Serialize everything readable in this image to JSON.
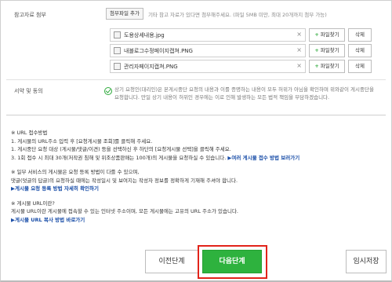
{
  "attachments": {
    "label": "참고자료 첨부",
    "add_button": "첨부파일 추가",
    "hint": "기타 참고 자료가 있다면 첨부해주세요. (파일 5MB 미만, 최대 20개까지 첨부 가능)",
    "find_label": "파일찾기",
    "delete_label": "삭제",
    "files": [
      {
        "name": "도용상세내용.jpg"
      },
      {
        "name": "내블로그수정페이지캡쳐.PNG"
      },
      {
        "name": "관리자페이지캡쳐.PNG"
      }
    ]
  },
  "signature": {
    "label": "서약 및 동의",
    "text": "상기 요청인(대리인)은 본게시중단 요청의 내용과 이를 증명하는 내용이 모두 허위가 아님을 확인하며 위와같이 게시중단을 요청합니다. 만일 상기 내용이 허위인 경우에는 이로 인해 발생하는 모든 법적 책임을 부담하겠습니다."
  },
  "notes": {
    "url_method_title": "※ URL 접수방법",
    "url_method_1": "1. 게시물의 URL주소 입력 후 [요청게시물 조회]를 클릭해 주세요.",
    "url_method_2": "1. 게시중단 요청 대상 (게시물/댓글/이견) 등을 선택하신 후 하단의 [요청게시물 선택]을 클릭해 주세요.",
    "url_method_3": "3. 1회 접수 시 최대 30개(저작권 침해 및 위조상품판매는 100개)의 게시물을 요청하실 수 있습니다.",
    "url_method_link": "▶여러 게시물 접수 방법 보러가기",
    "service_note_1": "※ 일부 서비스의 게시물은 요청 등록 방법이 다를 수 있으며,",
    "service_note_2": "댓글(덧글의 답글)의 요청하실 때에는 작성일시 및 보여지는 작성자 정보를 정확하게 기재해 주셔야 합니다.",
    "service_link": "▶게시물 요청 등록 방법 자세히 확인하기",
    "url_what_title": "※ 게시물 URL이란?",
    "url_what_text": "게시물 URL이란 게시물에 접속할 수 있는 인터넷 주소이며, 모든 게시물에는 고유의 URL 주소가 있습니다.",
    "url_copy_link": "▶게시물 URL 복사 방법 바로가기"
  },
  "footer": {
    "prev": "이전단계",
    "next": "다음단계",
    "save": "임시저장"
  },
  "colors": {
    "accent_green": "#2eb23e",
    "link_blue": "#1a4ea8",
    "highlight_red": "#e2231a"
  }
}
